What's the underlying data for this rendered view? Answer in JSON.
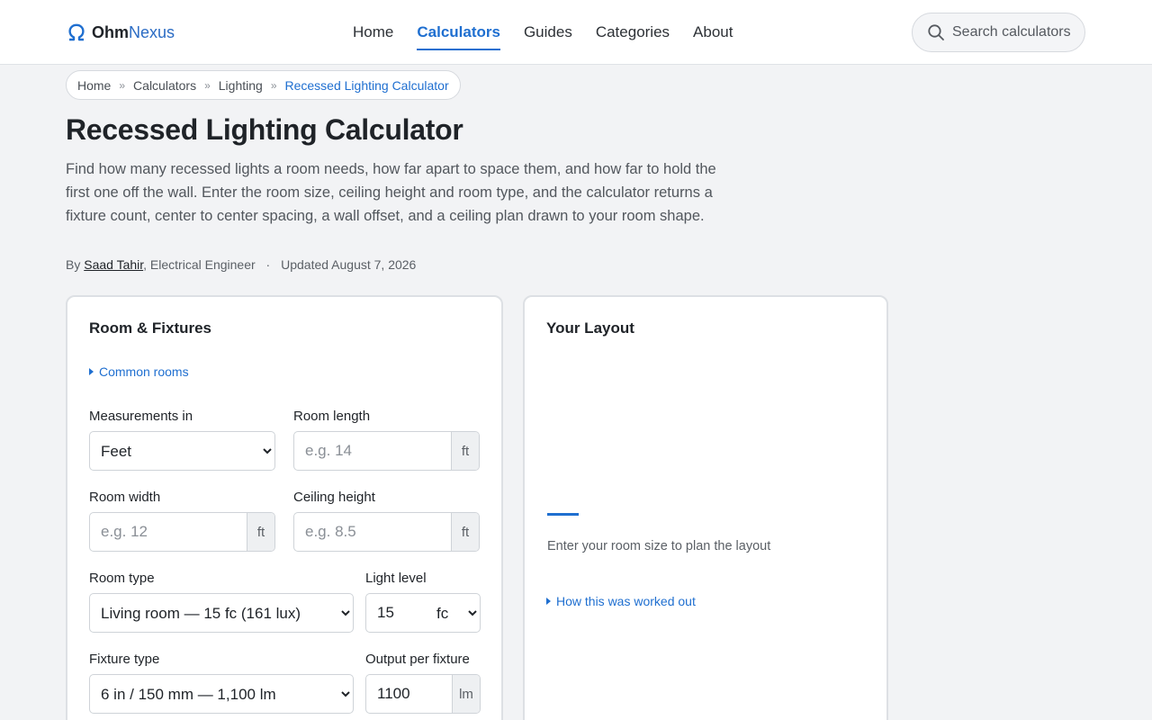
{
  "brand": {
    "name_a": "Ohm",
    "name_b": "Nexus",
    "accent": "#1f6fd0"
  },
  "nav": {
    "items": [
      {
        "label": "Home",
        "active": false
      },
      {
        "label": "Calculators",
        "active": true
      },
      {
        "label": "Guides",
        "active": false
      },
      {
        "label": "Categories",
        "active": false
      },
      {
        "label": "About",
        "active": false
      }
    ]
  },
  "search": {
    "placeholder": "Search calculators",
    "icon": "search-icon"
  },
  "breadcrumb": [
    "Home",
    "Calculators",
    "Lighting",
    "Recessed Lighting Calculator"
  ],
  "page": {
    "title": "Recessed Lighting Calculator",
    "intro": "Find how many recessed lights a room needs, how far apart to space them, and how far to hold the first one off the wall. Enter the room size, ceiling height and room type, and the calculator returns a fixture count, center to center spacing, a wall offset, and a ceiling plan drawn to your room shape.",
    "byline_prefix": "By",
    "author": "Saad Tahir",
    "author_role": ", Electrical Engineer",
    "separator": "·",
    "updated": "Updated August 7, 2026"
  },
  "form": {
    "title": "Room & Fixtures",
    "common_rooms": "Common rooms",
    "measurements": {
      "label": "Measurements in",
      "value": "Feet",
      "options": [
        "Feet"
      ]
    },
    "room_length": {
      "label": "Room length",
      "placeholder": "e.g. 14",
      "unit": "ft"
    },
    "room_width": {
      "label": "Room width",
      "placeholder": "e.g. 12",
      "unit": "ft"
    },
    "ceiling_height": {
      "label": "Ceiling height",
      "placeholder": "e.g. 8.5",
      "unit": "ft"
    },
    "room_type": {
      "label": "Room type",
      "value": "Living room — 15 fc (161 lux)",
      "options": [
        "Living room — 15 fc (161 lux)"
      ]
    },
    "light_level": {
      "label": "Light level",
      "value": "15",
      "unit_value": "fc",
      "unit_options": [
        "fc"
      ]
    },
    "fixture_type": {
      "label": "Fixture type",
      "value": "6 in / 150 mm — 1,100 lm",
      "options": [
        "6 in / 150 mm — 1,100 lm"
      ]
    },
    "output": {
      "label": "Output per fixture",
      "value": "1100",
      "unit": "lm"
    }
  },
  "results": {
    "title": "Your Layout",
    "empty_message": "Enter your room size to plan the layout",
    "how_worked": "How this was worked out"
  }
}
